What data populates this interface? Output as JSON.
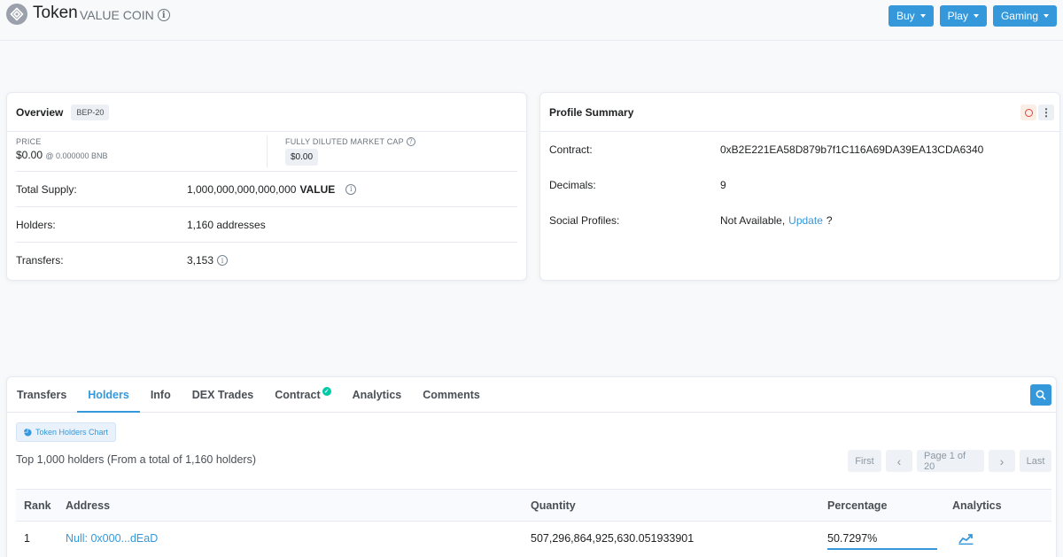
{
  "header": {
    "title": "Token",
    "subtitle": "VALUE COIN",
    "buttons": [
      {
        "label": "Buy"
      },
      {
        "label": "Play"
      },
      {
        "label": "Gaming"
      }
    ]
  },
  "overview": {
    "title": "Overview",
    "badge": "BEP-20",
    "price_label": "PRICE",
    "price_value": "$0.00",
    "price_bnb": "@ 0.000000 BNB",
    "mcap_label": "FULLY DILUTED MARKET CAP",
    "mcap_value": "$0.00",
    "rows": [
      {
        "label": "Total Supply:",
        "value": "1,000,000,000,000,000",
        "unit": "VALUE"
      },
      {
        "label": "Holders:",
        "value": "1,160 addresses"
      },
      {
        "label": "Transfers:",
        "value": "3,153"
      }
    ]
  },
  "profile": {
    "title": "Profile Summary",
    "contract_label": "Contract:",
    "contract_value": "0xB2E221EA58D879b7f1C116A69DA39EA13CDA6340",
    "decimals_label": "Decimals:",
    "decimals_value": "9",
    "social_label": "Social Profiles:",
    "social_value": "Not Available,",
    "social_link": "Update",
    "social_q": "?"
  },
  "tabs": [
    "Transfers",
    "Holders",
    "Info",
    "DEX Trades",
    "Contract",
    "Analytics",
    "Comments"
  ],
  "active_tab": "Holders",
  "holders": {
    "chart_button": "Token Holders Chart",
    "summary": "Top 1,000 holders (From a total of 1,160 holders)",
    "pager": {
      "first": "First",
      "prev": "‹",
      "page": "Page 1 of 20",
      "next": "›",
      "last": "Last"
    },
    "columns": {
      "rank": "Rank",
      "address": "Address",
      "quantity": "Quantity",
      "percentage": "Percentage",
      "analytics": "Analytics"
    },
    "rows": [
      {
        "rank": "1",
        "address": "Null: 0x000...dEaD",
        "quantity": "507,296,864,925,630.051933901",
        "percentage": "50.7297%",
        "percentage_value": 50.7297
      }
    ]
  },
  "colors": {
    "accent": "#3498db",
    "success": "#00c9a7"
  }
}
